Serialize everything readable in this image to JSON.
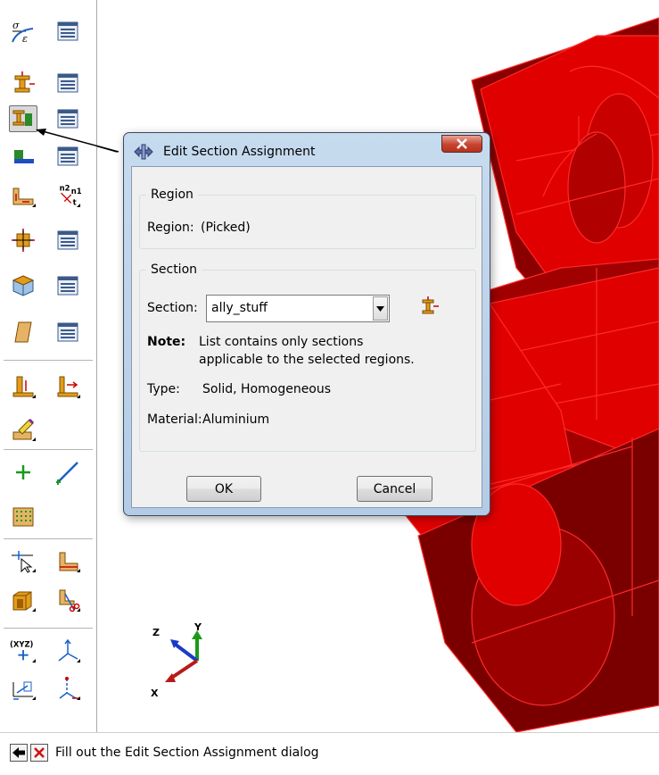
{
  "toolbox": {
    "icons_row1": [
      "material-stress-strain-icon",
      "material-manager-icon"
    ],
    "icons_row2": [
      "create-section-icon",
      "section-manager-icon"
    ],
    "icons_row3": [
      "assign-section-icon",
      "assignment-manager-icon"
    ],
    "icons_row4": [
      "assign-beam-orientation-icon",
      "orientation-manager-icon"
    ],
    "icons_row5": [
      "assign-material-orientation-icon",
      "normal-direction-icon"
    ],
    "icons_row6": [
      "create-profile-icon",
      "profile-manager-icon"
    ],
    "icons_row7": [
      "create-composite-icon",
      "composite-manager-icon"
    ],
    "icons_row8": [
      "create-skin-icon",
      "skin-manager-icon"
    ],
    "normal_label": "n2 n1 t",
    "csys_label": "(XYZ)"
  },
  "dialog": {
    "title": "Edit Section Assignment",
    "region_group": {
      "legend": "Region",
      "label": "Region:",
      "value": "(Picked)"
    },
    "section_group": {
      "legend": "Section",
      "section_label": "Section:",
      "section_value": "ally_stuff",
      "note_label": "Note:",
      "note_line1": "List contains only sections",
      "note_line2": "applicable to the selected regions.",
      "type_label": "Type:",
      "type_value": "Solid, Homogeneous",
      "material_label": "Material:",
      "material_value": "Aluminium"
    },
    "ok_label": "OK",
    "cancel_label": "Cancel"
  },
  "triad": {
    "x": "X",
    "y": "Y",
    "z": "Z"
  },
  "statusbar": {
    "prompt": "Fill out the Edit Section Assignment dialog"
  },
  "colors": {
    "part_red": "#e00000",
    "part_dark": "#7a0000",
    "edge_red": "#ff2a2a"
  }
}
